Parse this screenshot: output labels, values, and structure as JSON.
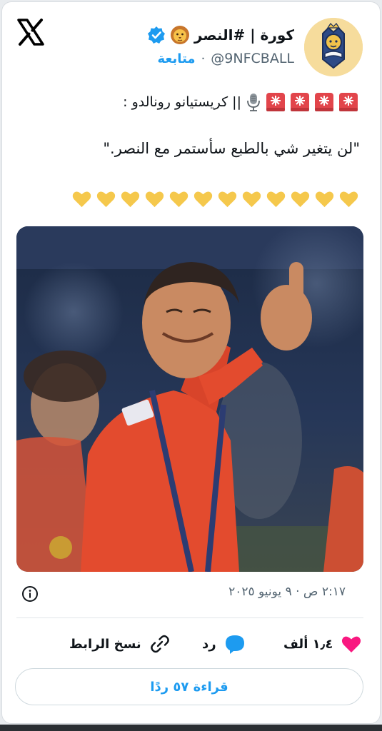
{
  "tweet": {
    "display_name": "كورة | #النصر",
    "handle": "@9NFCBALL",
    "separator": "·",
    "follow_label": "متابعة",
    "speaker_line": "|| كريستيانو رونالدو :",
    "quote_text": "\"لن يتغير شي بالطبع سأستمر مع النصر.\"",
    "heart_count": 12,
    "timestamp": "٢:١٧ ص · ٩ يونيو ٢٠٢٥"
  },
  "actions": {
    "likes_count": "١٫٤ ألف",
    "reply_label": "رد",
    "copy_link_label": "نسخ الرابط"
  },
  "read_replies_label": "قراءة ٥٧ ردًا",
  "colors": {
    "accent": "#1d9bf0",
    "text": "#0f1419",
    "muted": "#536471",
    "heart": "#f91880",
    "yellow_heart": "#f5c84c"
  }
}
